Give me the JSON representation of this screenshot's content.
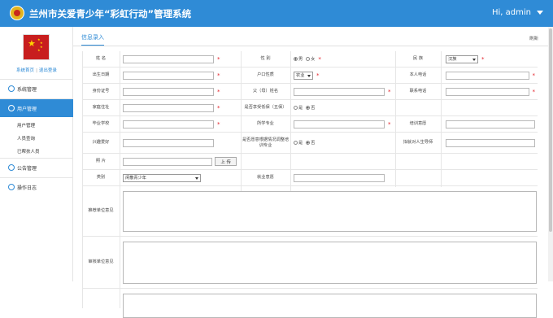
{
  "header": {
    "title": "兰州市关爱青少年“彩虹行动”管理系统",
    "greeting": "Hi, admin"
  },
  "sidebar": {
    "links": {
      "home": "系统首页",
      "logout": "退出登录"
    },
    "groups": [
      {
        "label": "系统管理",
        "icon": "circle-icon"
      },
      {
        "label": "用户管理",
        "icon": "headset-icon"
      },
      {
        "label": "公告管理",
        "icon": "circle-icon"
      },
      {
        "label": "操作日志",
        "icon": "circle-icon"
      }
    ],
    "subitems": [
      "用户管理",
      "人员查询",
      "已帮扶人员"
    ]
  },
  "main": {
    "tab": "信息录入",
    "refresh": "刷新",
    "fields": {
      "name": "姓    名",
      "gender": "性    别",
      "gender_male": "男",
      "gender_female": "女",
      "ethnicity": "民    族",
      "ethnicity_value": "汉族",
      "birth": "出生日期",
      "hukou": "户口性质",
      "hukou_value": "农业",
      "phone_self": "本人电话",
      "idcard": "身份证号",
      "parent": "父（母）姓名",
      "phone_contact": "联系电话",
      "address": "家庭住址",
      "poor": "是否享受低保（五保）",
      "yes": "是",
      "no": "否",
      "school": "毕业学校",
      "major": "所学专业",
      "training_wish": "培训意愿",
      "hobby": "兴趣爱好",
      "adjust": "是否愿意根据情况调整培训专业",
      "target_school": "拟就对人生导师",
      "photo": "照    片",
      "upload": "上 传",
      "category": "类别",
      "category_value": "闲散青少年",
      "employment": "就业意愿",
      "recommend_opinion": "推荐单位意见",
      "review_opinion": "审核单位意见"
    }
  }
}
